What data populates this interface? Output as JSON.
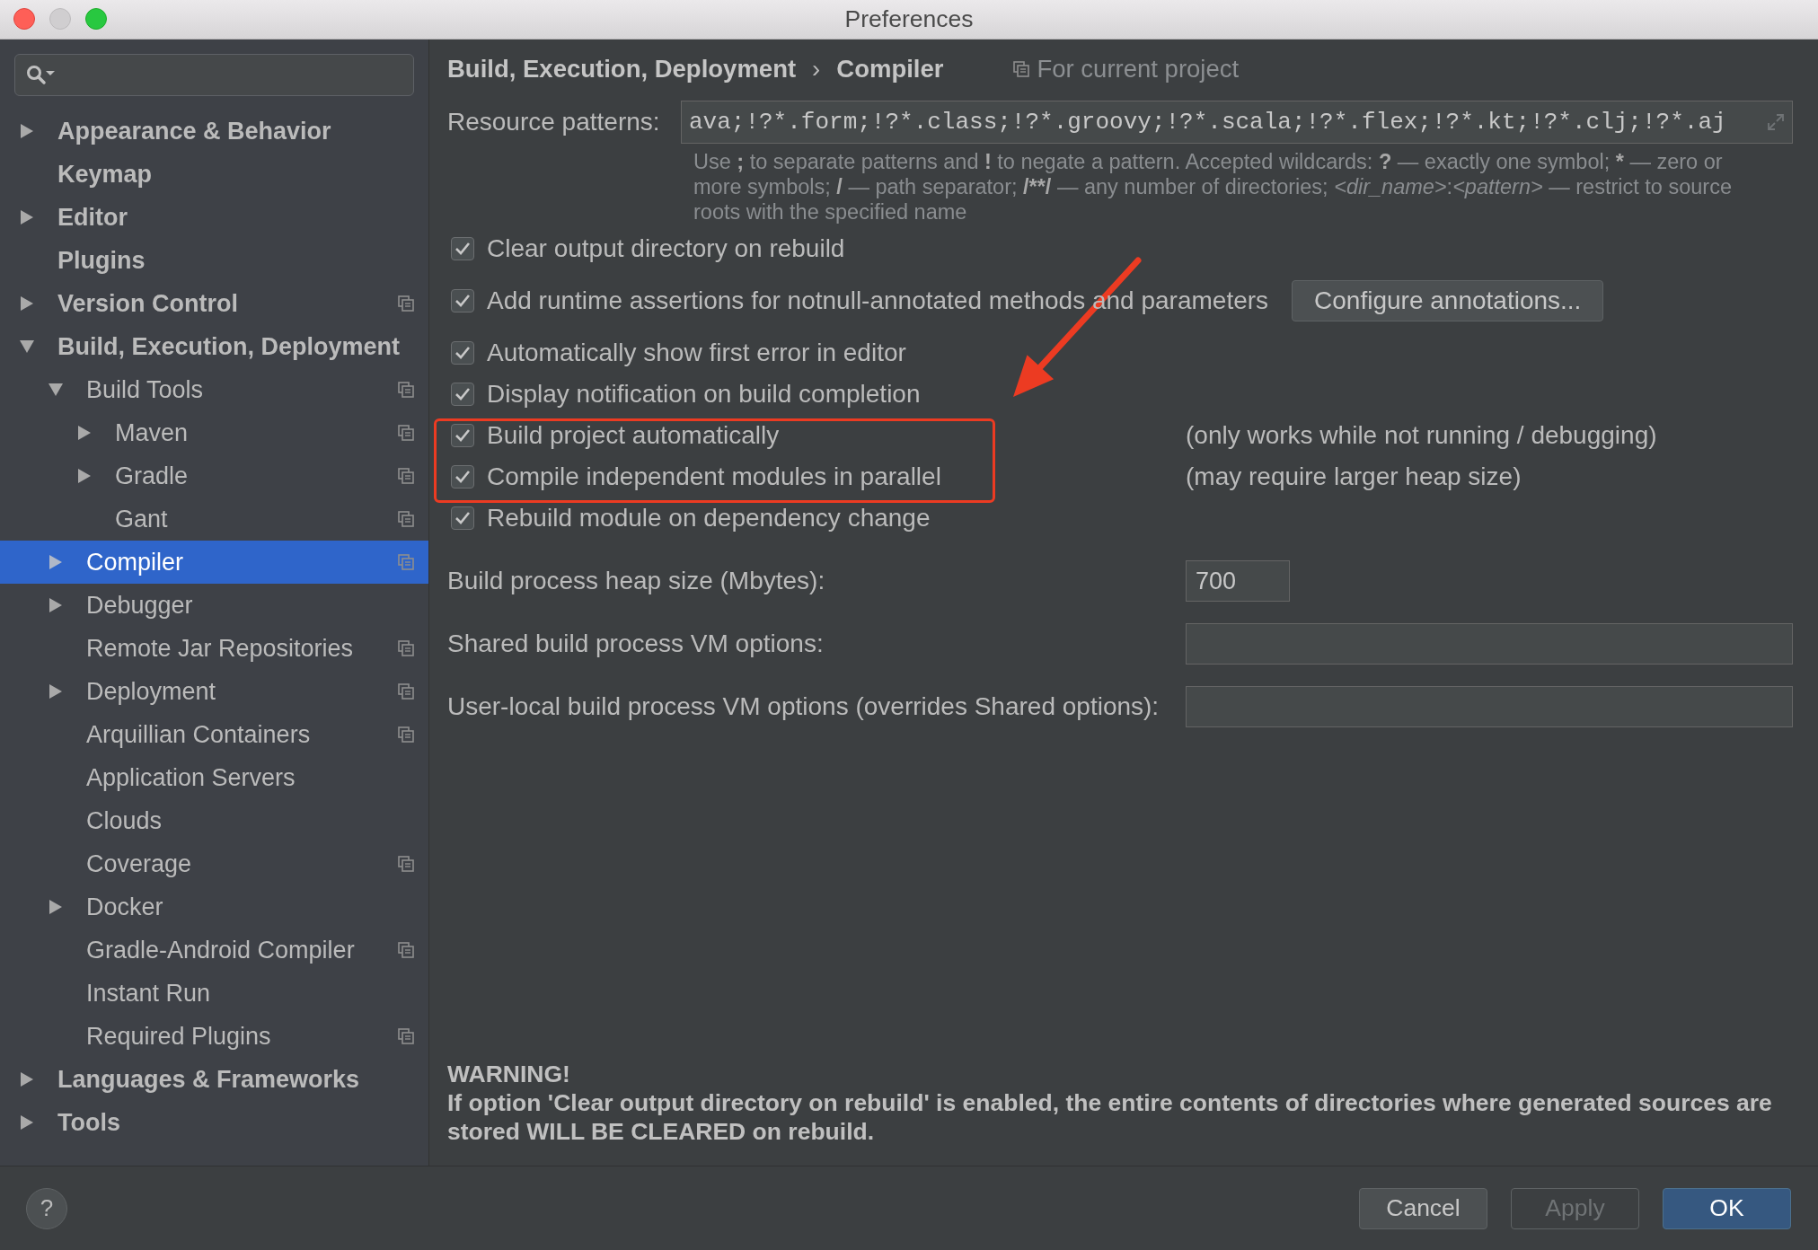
{
  "window": {
    "title": "Preferences"
  },
  "sidebar": {
    "items": [
      {
        "label": "Appearance & Behavior",
        "kind": "group",
        "expanded": false,
        "per_project": false,
        "selected": false
      },
      {
        "label": "Keymap",
        "kind": "page",
        "per_project": false,
        "selected": false
      },
      {
        "label": "Editor",
        "kind": "group",
        "expanded": false,
        "per_project": false,
        "selected": false
      },
      {
        "label": "Plugins",
        "kind": "page",
        "per_project": false,
        "selected": false
      },
      {
        "label": "Version Control",
        "kind": "group",
        "expanded": false,
        "per_project": true,
        "selected": false
      },
      {
        "label": "Build, Execution, Deployment",
        "kind": "group",
        "expanded": true,
        "per_project": false,
        "selected": false,
        "children": [
          {
            "label": "Build Tools",
            "kind": "group",
            "expanded": true,
            "per_project": true,
            "selected": false,
            "children": [
              {
                "label": "Maven",
                "kind": "group",
                "expanded": false,
                "per_project": true,
                "selected": false
              },
              {
                "label": "Gradle",
                "kind": "group",
                "expanded": false,
                "per_project": true,
                "selected": false
              },
              {
                "label": "Gant",
                "kind": "page",
                "per_project": true,
                "selected": false
              }
            ]
          },
          {
            "label": "Compiler",
            "kind": "group",
            "expanded": false,
            "per_project": true,
            "selected": true
          },
          {
            "label": "Debugger",
            "kind": "group",
            "expanded": false,
            "per_project": false,
            "selected": false
          },
          {
            "label": "Remote Jar Repositories",
            "kind": "page",
            "per_project": true,
            "selected": false
          },
          {
            "label": "Deployment",
            "kind": "group",
            "expanded": false,
            "per_project": true,
            "selected": false
          },
          {
            "label": "Arquillian Containers",
            "kind": "page",
            "per_project": true,
            "selected": false
          },
          {
            "label": "Application Servers",
            "kind": "page",
            "per_project": false,
            "selected": false
          },
          {
            "label": "Clouds",
            "kind": "page",
            "per_project": false,
            "selected": false
          },
          {
            "label": "Coverage",
            "kind": "page",
            "per_project": true,
            "selected": false
          },
          {
            "label": "Docker",
            "kind": "group",
            "expanded": false,
            "per_project": false,
            "selected": false
          },
          {
            "label": "Gradle-Android Compiler",
            "kind": "page",
            "per_project": true,
            "selected": false
          },
          {
            "label": "Instant Run",
            "kind": "page",
            "per_project": false,
            "selected": false
          },
          {
            "label": "Required Plugins",
            "kind": "page",
            "per_project": true,
            "selected": false
          }
        ]
      },
      {
        "label": "Languages & Frameworks",
        "kind": "group",
        "expanded": false,
        "per_project": false,
        "selected": false
      },
      {
        "label": "Tools",
        "kind": "group",
        "expanded": false,
        "per_project": false,
        "selected": false
      }
    ]
  },
  "breadcrumb": {
    "parent": "Build, Execution, Deployment",
    "separator": "›",
    "current": "Compiler",
    "scope": "For current project"
  },
  "resource_patterns": {
    "label": "Resource patterns:",
    "value": "ava;!?*.form;!?*.class;!?*.groovy;!?*.scala;!?*.flex;!?*.kt;!?*.clj;!?*.aj",
    "hint": [
      {
        "text": "Use ",
        "kind": "plain"
      },
      {
        "text": ";",
        "kind": "bold"
      },
      {
        "text": " to separate patterns and ",
        "kind": "plain"
      },
      {
        "text": "!",
        "kind": "bold"
      },
      {
        "text": " to negate a pattern. Accepted wildcards: ",
        "kind": "plain"
      },
      {
        "text": "?",
        "kind": "bold"
      },
      {
        "text": " — exactly one symbol; ",
        "kind": "plain"
      },
      {
        "text": "*",
        "kind": "bold"
      },
      {
        "text": " — zero or more symbols; ",
        "kind": "plain"
      },
      {
        "text": "/",
        "kind": "bold"
      },
      {
        "text": " — path separator; ",
        "kind": "plain"
      },
      {
        "text": "/**/",
        "kind": "bold"
      },
      {
        "text": " — any number of directories; ",
        "kind": "plain"
      },
      {
        "text": "<dir_name>",
        "kind": "italic"
      },
      {
        "text": ":",
        "kind": "plain"
      },
      {
        "text": "<pattern>",
        "kind": "italic"
      },
      {
        "text": " — restrict to source roots with the specified name",
        "kind": "plain"
      }
    ]
  },
  "options": [
    {
      "label": "Clear output directory on rebuild",
      "checked": true
    },
    {
      "label": "Add runtime assertions for notnull-annotated methods and parameters",
      "checked": true,
      "button": "Configure annotations..."
    },
    {
      "label": "Automatically show first error in editor",
      "checked": true
    },
    {
      "label": "Display notification on build completion",
      "checked": true
    },
    {
      "label": "Build project automatically",
      "checked": true,
      "note": "(only works while not running / debugging)"
    },
    {
      "label": "Compile independent modules in parallel",
      "checked": true,
      "note": "(may require larger heap size)"
    },
    {
      "label": "Rebuild module on dependency change",
      "checked": true
    }
  ],
  "fields": [
    {
      "label": "Build process heap size (Mbytes):",
      "kind": "short",
      "value": "700"
    },
    {
      "label": "Shared build process VM options:",
      "kind": "wide"
    },
    {
      "label": "User-local build process VM options (overrides Shared options):",
      "kind": "wide"
    }
  ],
  "warning": {
    "title": "WARNING!",
    "text": "If option 'Clear output directory on rebuild' is enabled, the entire contents of directories where generated sources are stored WILL BE CLEARED on rebuild."
  },
  "help": {
    "label": "?"
  },
  "buttons": [
    {
      "label": "Cancel",
      "disabled": false,
      "default": false
    },
    {
      "label": "Apply",
      "disabled": true,
      "default": false
    },
    {
      "label": "OK",
      "disabled": false,
      "default": true
    }
  ]
}
